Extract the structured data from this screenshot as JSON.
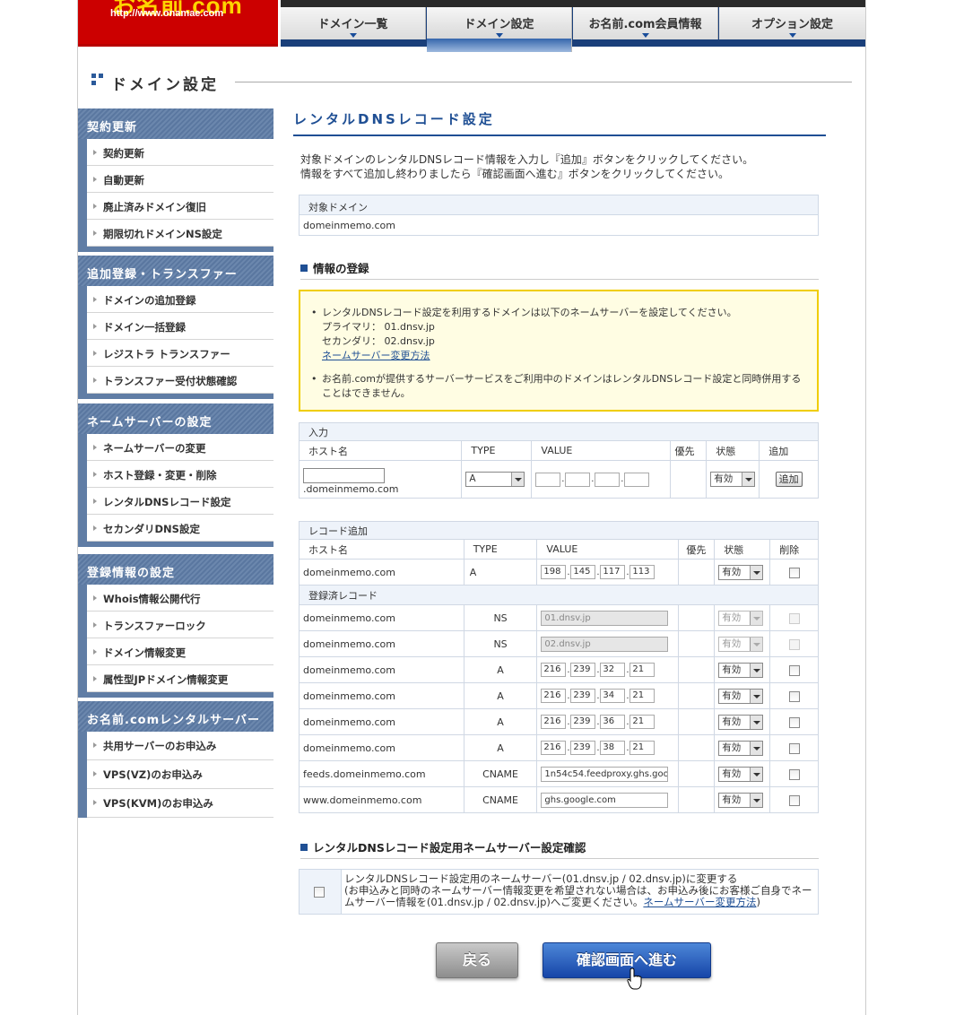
{
  "header": {
    "logo_text": "お名前.com",
    "logo_url": "http://www.onamae.com",
    "nav": [
      {
        "label": "ドメイン一覧"
      },
      {
        "label": "ドメイン設定"
      },
      {
        "label": "お名前.com会員情報"
      },
      {
        "label": "オプション設定"
      }
    ],
    "active_nav": "ドメイン設定"
  },
  "page_title": "ドメイン設定",
  "sidebar": [
    {
      "title": "契約更新",
      "items": [
        "契約更新",
        "自動更新",
        "廃止済みドメイン復旧",
        "期限切れドメインNS設定"
      ]
    },
    {
      "title": "追加登録・トランスファー",
      "items": [
        "ドメインの追加登録",
        "ドメイン一括登録",
        "レジストラ トランスファー",
        "トランスファー受付状態確認"
      ]
    },
    {
      "title": "ネームサーバーの設定",
      "items": [
        "ネームサーバーの変更",
        "ホスト登録・変更・削除",
        "レンタルDNSレコード設定",
        "セカンダリDNS設定"
      ]
    },
    {
      "title": "登録情報の設定",
      "items": [
        "Whois情報公開代行",
        "トランスファーロック",
        "ドメイン情報変更",
        "属性型JPドメイン情報変更"
      ]
    },
    {
      "title": "お名前.comレンタルサーバー",
      "items": [
        "共用サーバーのお申込み",
        "VPS(VZ)のお申込み",
        "VPS(KVM)のお申込み"
      ]
    }
  ],
  "main": {
    "title": "レンタルDNSレコード設定",
    "intro_line1": "対象ドメインのレンタルDNSレコード情報を入力し『追加』ボタンをクリックしてください。",
    "intro_line2": "情報をすべて追加し終わりましたら『確認画面へ進む』ボタンをクリックしてください。",
    "target_label": "対象ドメイン",
    "target_domain": "domeinmemo.com",
    "info_heading": "情報の登録",
    "notice": {
      "line1": "レンタルDNSレコード設定を利用するドメインは以下のネームサーバーを設定してください。",
      "primary": "プライマリ： 01.dnsv.jp",
      "secondary": "セカンダリ： 02.dnsv.jp",
      "link": "ネームサーバー変更方法",
      "line2": "お名前.comが提供するサーバーサービスをご利用中のドメインはレンタルDNSレコード設定と同時併用することはできません。"
    },
    "input_table": {
      "caption": "入力",
      "headers": {
        "host": "ホスト名",
        "type": "TYPE",
        "value": "VALUE",
        "priority": "優先",
        "status": "状態",
        "add": "追加"
      },
      "domain_suffix": ".domeinmemo.com",
      "type_value": "A",
      "status_value": "有効",
      "add_button": "追加"
    },
    "record_table": {
      "caption": "レコード追加",
      "headers": {
        "host": "ホスト名",
        "type": "TYPE",
        "value": "VALUE",
        "priority": "優先",
        "status": "状態",
        "delete": "削除"
      },
      "new_record": {
        "host": "domeinmemo.com",
        "type": "A",
        "ip": [
          "198",
          "145",
          "117",
          "113"
        ],
        "status": "有効"
      },
      "registered_caption": "登録済レコード",
      "registered": [
        {
          "host": "domeinmemo.com",
          "type": "NS",
          "value": "01.dnsv.jp",
          "status": "有効"
        },
        {
          "host": "domeinmemo.com",
          "type": "NS",
          "value": "02.dnsv.jp",
          "status": "有効"
        },
        {
          "host": "domeinmemo.com",
          "type": "A",
          "ip": [
            "216",
            "239",
            "32",
            "21"
          ],
          "status": "有効"
        },
        {
          "host": "domeinmemo.com",
          "type": "A",
          "ip": [
            "216",
            "239",
            "34",
            "21"
          ],
          "status": "有効"
        },
        {
          "host": "domeinmemo.com",
          "type": "A",
          "ip": [
            "216",
            "239",
            "36",
            "21"
          ],
          "status": "有効"
        },
        {
          "host": "domeinmemo.com",
          "type": "A",
          "ip": [
            "216",
            "239",
            "38",
            "21"
          ],
          "status": "有効"
        },
        {
          "host": "feeds.domeinmemo.com",
          "type": "CNAME",
          "value": "1n54c54.feedproxy.ghs.goo",
          "status": "有効"
        },
        {
          "host": "www.domeinmemo.com",
          "type": "CNAME",
          "value": "ghs.google.com",
          "status": "有効"
        }
      ]
    },
    "confirm_heading": "レンタルDNSレコード設定用ネームサーバー設定確認",
    "confirm_line1": "レンタルDNSレコード設定用のネームサーバー(01.dnsv.jp / 02.dnsv.jp)に変更する",
    "confirm_line2": "(お申込みと同時のネームサーバー情報変更を希望されない場合は、お申込み後にお客様ご自身でネームサーバー情報を(01.dnsv.jp / 02.dnsv.jp)へご変更ください。",
    "confirm_link": "ネームサーバー変更方法",
    "confirm_close": ")",
    "back_button": "戻る",
    "next_button": "確認画面へ進む"
  }
}
